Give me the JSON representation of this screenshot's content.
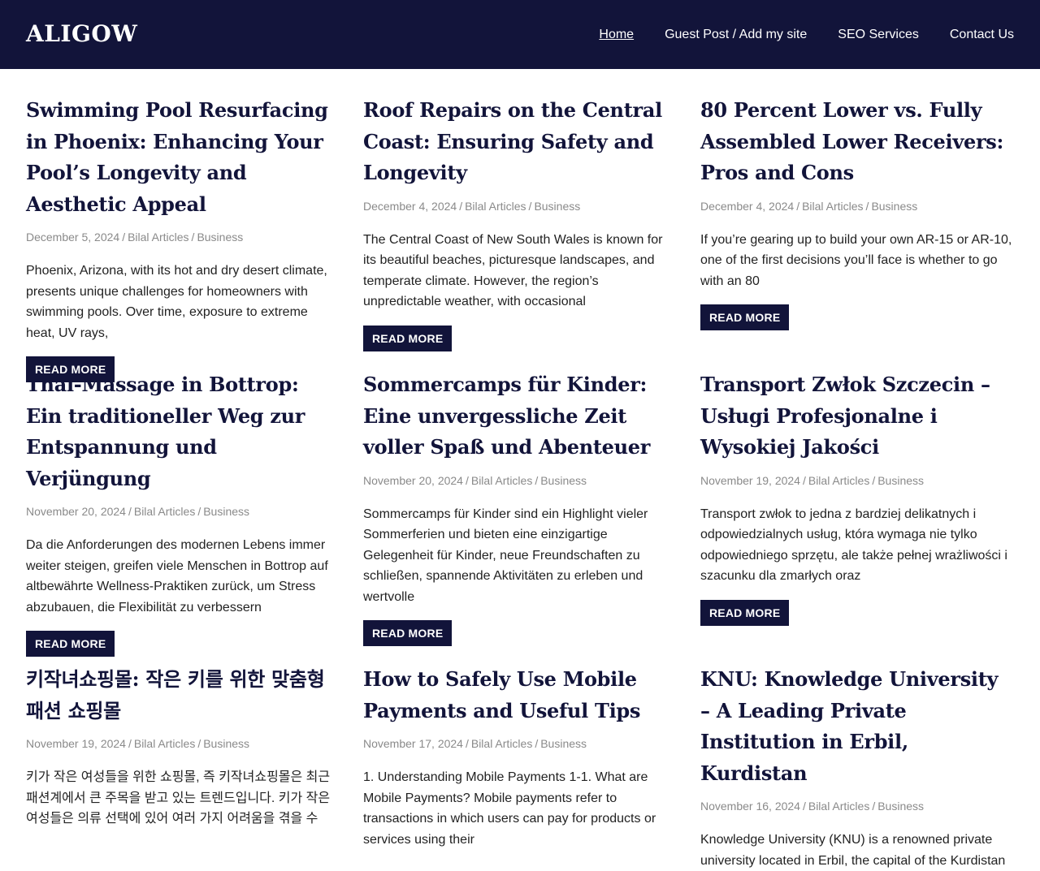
{
  "header": {
    "logo": "ALIGOW",
    "nav": [
      {
        "label": "Home",
        "active": true
      },
      {
        "label": "Guest Post / Add my site",
        "active": false
      },
      {
        "label": "SEO Services",
        "active": false
      },
      {
        "label": "Contact Us",
        "active": false
      }
    ]
  },
  "read_more_label": "READ MORE",
  "posts": [
    {
      "title": "Swimming Pool Resurfacing in Phoenix: Enhancing Your Pool’s Longevity and Aesthetic Appeal",
      "date": "December 5, 2024",
      "author": "Bilal Articles",
      "category": "Business",
      "excerpt": "Phoenix, Arizona, with its hot and dry desert climate, presents unique challenges for homeowners with swimming pools. Over time, exposure to extreme heat, UV rays,"
    },
    {
      "title": "Roof Repairs on the Central Coast: Ensuring Safety and Longevity",
      "date": "December 4, 2024",
      "author": "Bilal Articles",
      "category": "Business",
      "excerpt": "The Central Coast of New South Wales is known for its beautiful beaches, picturesque landscapes, and temperate climate. However, the region’s unpredictable weather, with occasional"
    },
    {
      "title": "80 Percent Lower vs. Fully Assembled Lower Receivers: Pros and Cons",
      "date": "December 4, 2024",
      "author": "Bilal Articles",
      "category": "Business",
      "excerpt": "If you’re gearing up to build your own AR-15 or AR-10, one of the first decisions you’ll face is whether to go with an 80"
    },
    {
      "title": "Thai-Massage in Bottrop: Ein traditioneller Weg zur Entspannung und Verjüngung",
      "date": "November 20, 2024",
      "author": "Bilal Articles",
      "category": "Business",
      "excerpt": "Da die Anforderungen des modernen Lebens immer weiter steigen, greifen viele Menschen in Bottrop auf altbewährte Wellness-Praktiken zurück, um Stress abzubauen, die Flexibilität zu verbessern"
    },
    {
      "title": "Sommercamps für Kinder: Eine unvergessliche Zeit voller Spaß und Abenteuer",
      "date": "November 20, 2024",
      "author": "Bilal Articles",
      "category": "Business",
      "excerpt": "Sommercamps für Kinder sind ein Highlight vieler Sommerferien und bieten eine einzigartige Gelegenheit für Kinder, neue Freundschaften zu schließen, spannende Aktivitäten zu erleben und wertvolle"
    },
    {
      "title": "Transport Zwłok Szczecin – Usługi Profesjonalne i Wysokiej Jakości",
      "date": "November 19, 2024",
      "author": "Bilal Articles",
      "category": "Business",
      "excerpt": "Transport zwłok to jedna z bardziej delikatnych i odpowiedzialnych usług, która wymaga nie tylko odpowiedniego sprzętu, ale także pełnej wrażliwości i szacunku dla zmarłych oraz"
    },
    {
      "title": "키작녀쇼핑몰: 작은 키를 위한 맞춤형 패션 쇼핑몰",
      "date": "November 19, 2024",
      "author": "Bilal Articles",
      "category": "Business",
      "excerpt": "키가 작은 여성들을 위한 쇼핑몰, 즉 키작녀쇼핑몰은 최근 패션계에서 큰 주목을 받고 있는 트렌드입니다. 키가 작은 여성들은 의류 선택에 있어 여러 가지 어려움을 겪을 수"
    },
    {
      "title": "How to Safely Use Mobile Payments and Useful Tips",
      "date": "November 17, 2024",
      "author": "Bilal Articles",
      "category": "Business",
      "excerpt": "1. Understanding Mobile Payments 1-1. What are Mobile Payments? Mobile payments refer to transactions in which users can pay for products or services using their"
    },
    {
      "title": "KNU: Knowledge University – A Leading Private Institution in Erbil, Kurdistan",
      "date": "November 16, 2024",
      "author": "Bilal Articles",
      "category": "Business",
      "excerpt": "Knowledge University (KNU) is a renowned private university located in Erbil, the capital of the Kurdistan"
    }
  ]
}
